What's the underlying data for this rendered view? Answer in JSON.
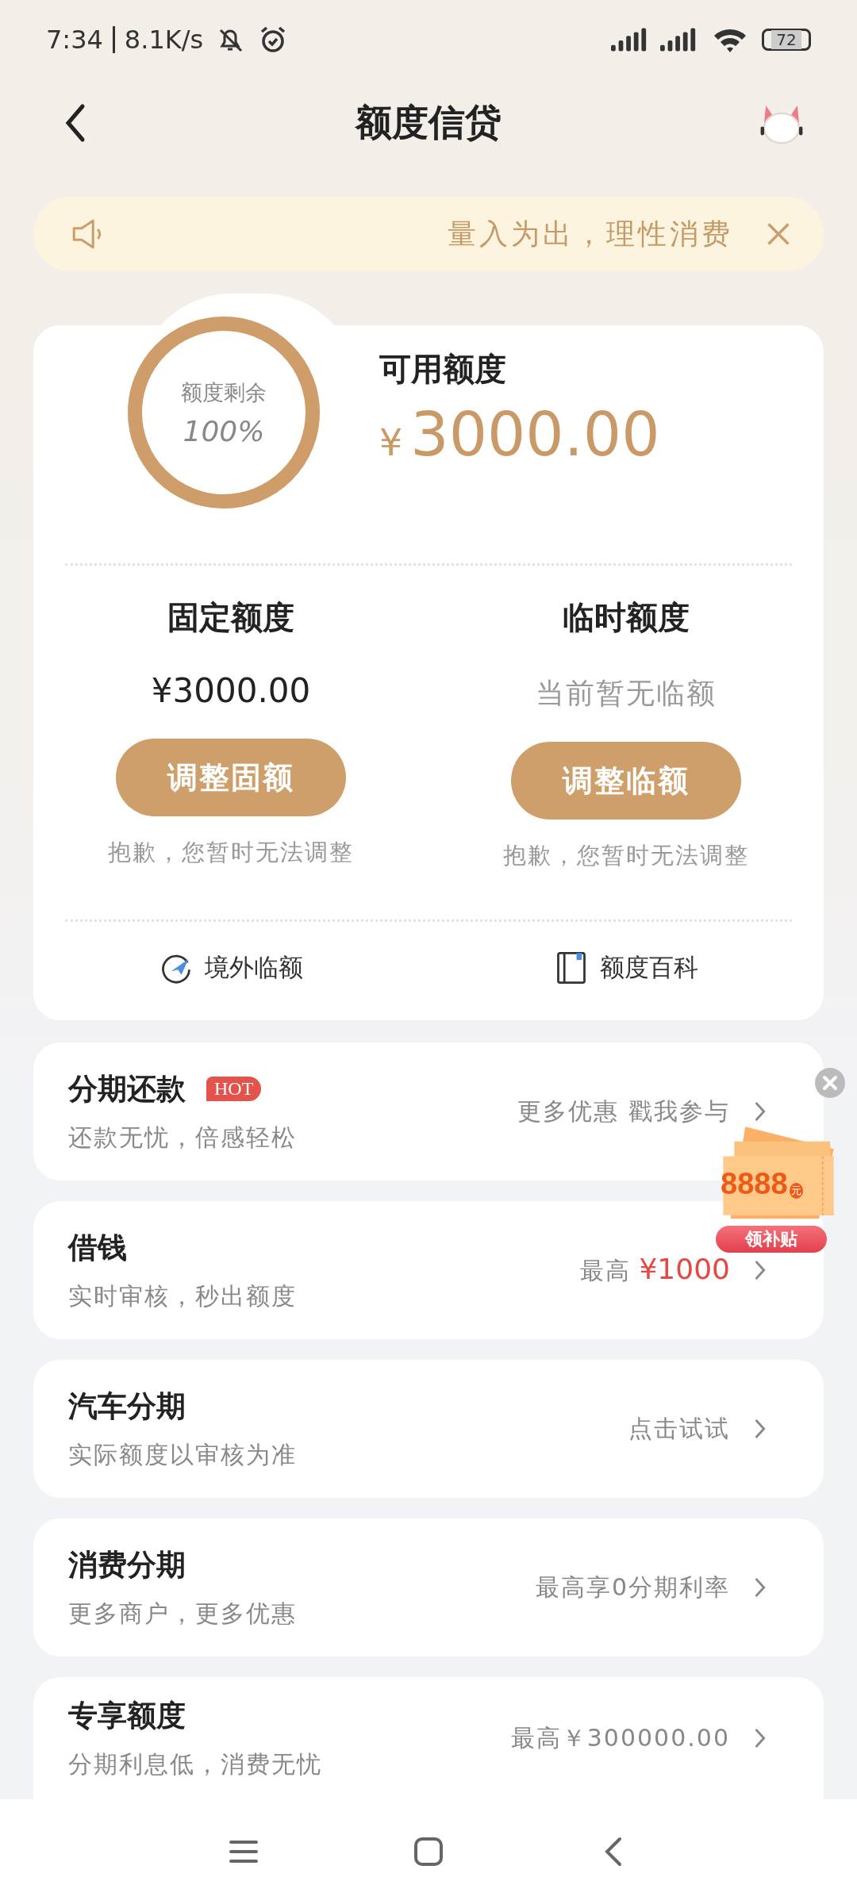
{
  "status_bar": {
    "time": "7:34",
    "speed": "8.1K/s",
    "battery": "72"
  },
  "header": {
    "title": "额度信贷"
  },
  "notice": {
    "text": "量入为出，理性消费"
  },
  "quota": {
    "ring_label": "额度剩余",
    "ring_value": "100%",
    "level": 1,
    "available_label": "可用额度",
    "currency": "¥",
    "amount": "3000.00"
  },
  "columns": [
    {
      "title": "固定额度",
      "value": "¥3000.00",
      "kind": "amount",
      "button": "调整固额",
      "note": "抱歉，您暂时无法调整"
    },
    {
      "title": "临时额度",
      "value": "当前暂无临额",
      "kind": "note",
      "button": "调整临额",
      "note": "抱歉，您暂时无法调整"
    }
  ],
  "links": [
    {
      "label": "境外临额",
      "kind": "plane"
    },
    {
      "label": "额度百科",
      "kind": "book"
    }
  ],
  "products": [
    {
      "title": "分期还款",
      "badge": "HOT",
      "subtitle": "还款无忧，倍感轻松",
      "action": "更多优惠 戳我参与"
    },
    {
      "title": "借钱",
      "subtitle": "实时审核，秒出额度",
      "action": "最高",
      "action_value": "¥1000"
    },
    {
      "title": "汽车分期",
      "subtitle": "实际额度以审核为准",
      "action": "点击试试"
    },
    {
      "title": "消费分期",
      "subtitle": "更多商户，更多优惠",
      "action": "最高享0分期利率"
    },
    {
      "title": "专享额度",
      "subtitle": "分期利息低，消费无忧",
      "action": "最高￥300000.00"
    }
  ],
  "promo": {
    "amount": "8888",
    "unit": "元",
    "button": "领补贴"
  }
}
